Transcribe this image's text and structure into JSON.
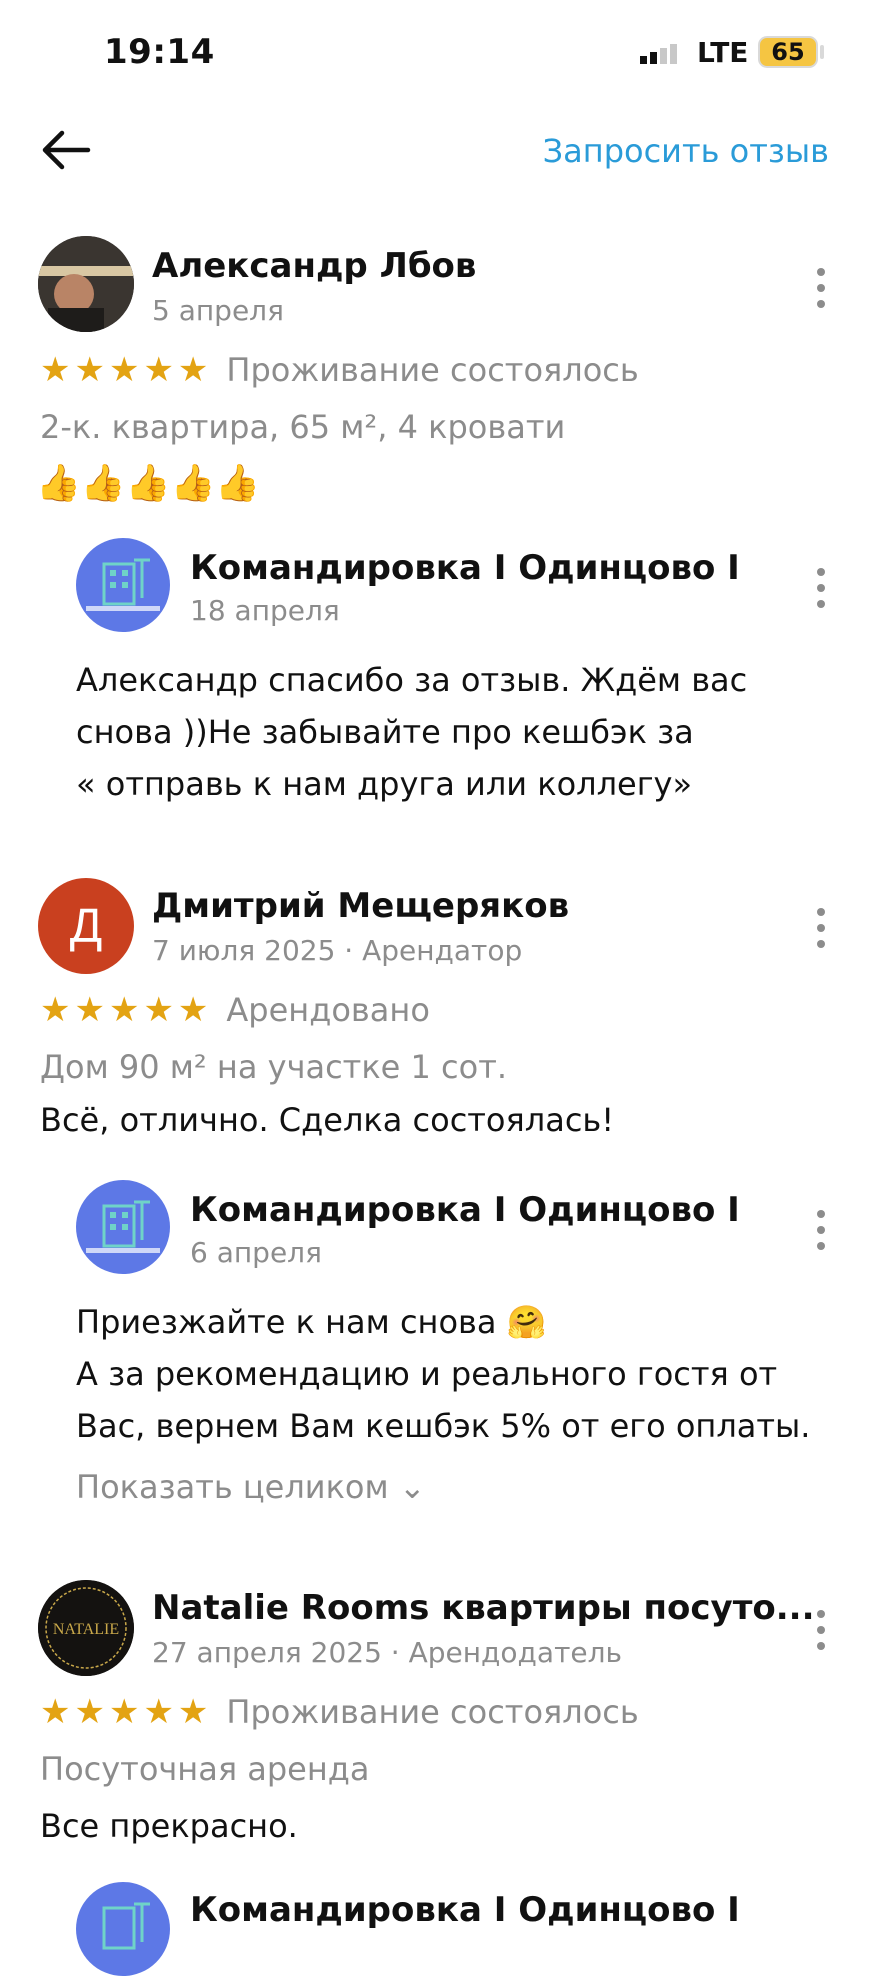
{
  "status": {
    "time": "19:14",
    "network": "LTE",
    "battery": "65"
  },
  "nav": {
    "request_review": "Запросить отзыв",
    "back_icon": "arrow-left-icon"
  },
  "reviews": [
    {
      "author": "Александр Лбов",
      "date": "5 апреля",
      "stars": "★★★★★",
      "stay_status": "Проживание состоялось",
      "details": "2-к. квартира, 65 м², 4 кровати",
      "text": "👍👍👍👍👍",
      "reply": {
        "author": "Командировка I Одинцово I",
        "date": "18 апреля",
        "lines": [
          "Александр спасибо за отзыв. Ждём вас",
          "снова ))Не забывайте про кешбэк за",
          "« отправь к нам друга или коллегу»"
        ]
      }
    },
    {
      "author": "Дмитрий Мещеряков",
      "avatar_letter": "Д",
      "date": "7 июля 2025 · Арендатор",
      "stars": "★★★★★",
      "stay_status": "Арендовано",
      "details": "Дом 90 м² на участке 1 сот.",
      "text": "Всё, отлично. Сделка состоялась!",
      "reply": {
        "author": "Командировка I Одинцово I",
        "date": "6 апреля",
        "lines": [
          "Приезжайте к нам снова 🤗",
          "А за рекомендацию и реального гостя от",
          "Вас,  вернем  Вам кешбэк 5% от его оплаты."
        ],
        "show_more": "Показать целиком ⌄"
      }
    },
    {
      "author": "Natalie Rooms квартиры посуто...",
      "date": "27 апреля 2025 · Арендодатель",
      "stars": "★★★★★",
      "stay_status": "Проживание состоялось",
      "details": "Посуточная аренда",
      "text": "Все прекрасно.",
      "reply": {
        "author": "Командировка I Одинцово I"
      }
    }
  ],
  "colors": {
    "accent": "#2a9bd8",
    "star": "#e3a313",
    "muted": "#8c8c8c",
    "reply_avatar": "#5d78e6",
    "letter_avatar": "#c9401f"
  }
}
